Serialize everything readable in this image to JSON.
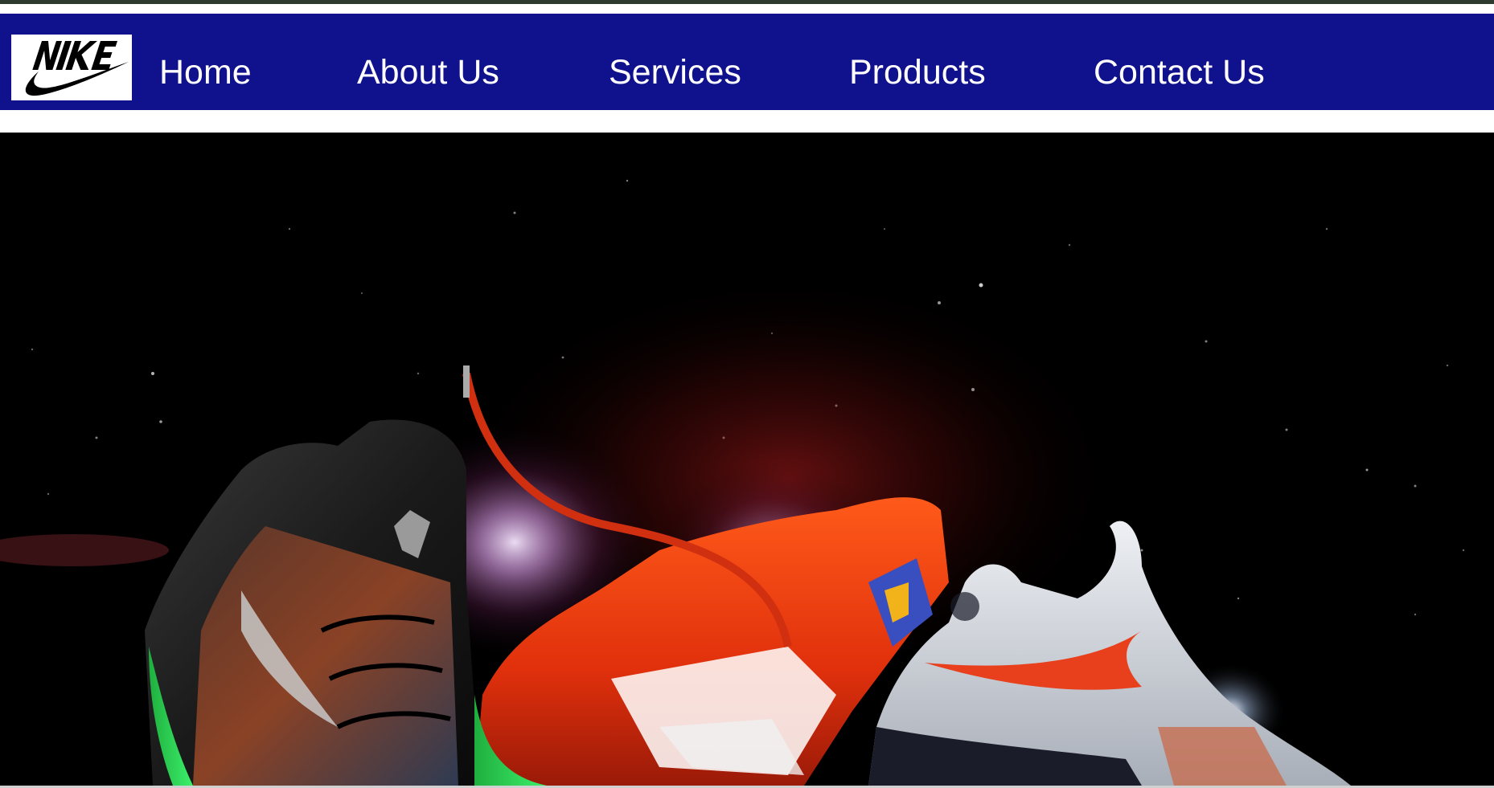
{
  "brand": {
    "logo_icon": "nike-swoosh-logo",
    "logo_text": "NIKE"
  },
  "nav": {
    "items": [
      {
        "label": "Home"
      },
      {
        "label": "About Us"
      },
      {
        "label": "Services"
      },
      {
        "label": "Products"
      },
      {
        "label": "Contact Us"
      }
    ]
  },
  "hero": {
    "image": "nike-sneakers-space-banner"
  },
  "colors": {
    "navbar": "#10118c",
    "nav_text": "#ffffff",
    "topline": "#2f3a2f",
    "hero_bg": "#000000"
  }
}
